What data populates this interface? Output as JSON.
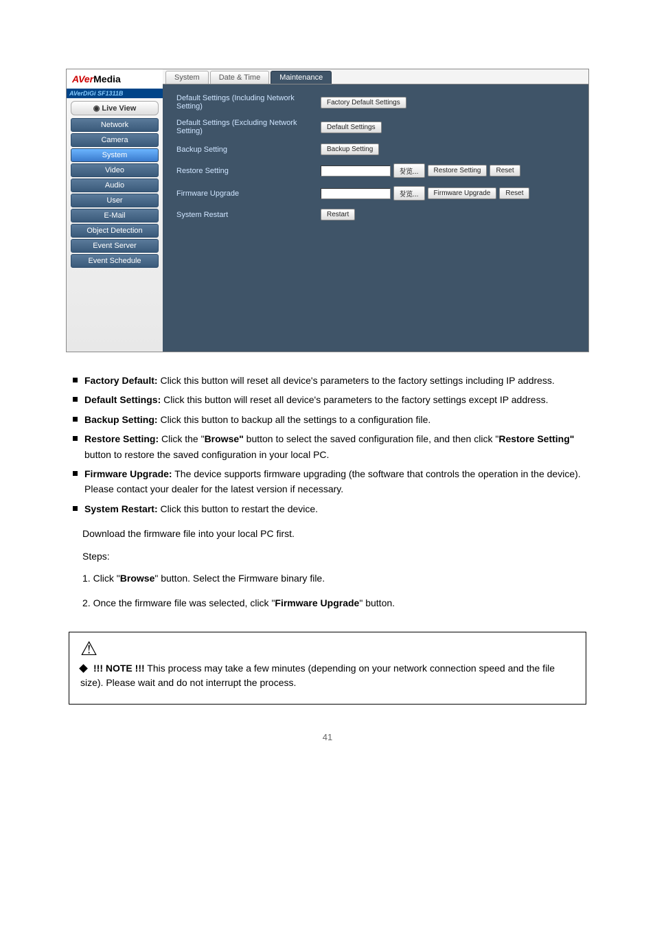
{
  "screenshot": {
    "sidebar": {
      "logo_part1": "AVer",
      "logo_part2": "Media",
      "sublogo": "AVerDiGi SF1311B",
      "live_view": "◉ Live View",
      "items": [
        "Network",
        "Camera",
        "System",
        "Video",
        "Audio",
        "User",
        "E-Mail",
        "Object Detection",
        "Event Server",
        "Event Schedule"
      ],
      "active_index": 2
    },
    "tabs": [
      "System",
      "Date & Time",
      "Maintenance"
    ],
    "active_tab": 2,
    "rows": {
      "r1_label": "Default Settings (Including Network Setting)",
      "r1_btn": "Factory Default Settings",
      "r2_label": "Default Settings (Excluding Network Setting)",
      "r2_btn": "Default Settings",
      "r3_label": "Backup Setting",
      "r3_btn": "Backup Setting",
      "r4_label": "Restore Setting",
      "r4_browse": "찾览...",
      "r4_btn1": "Restore Setting",
      "r4_btn2": "Reset",
      "r5_label": "Firmware Upgrade",
      "r5_browse": "찾览...",
      "r5_btn1": "Firmware Upgrade",
      "r5_btn2": "Reset",
      "r6_label": "System Restart",
      "r6_btn": "Restart"
    }
  },
  "bullets": {
    "b1a": "Factory Default:",
    "b1b": " Click this butt",
    "b1c": "on will reset all device's parameters to the factory settings ",
    "b1d": "including IP address.",
    "b2a": "Default Settings:",
    "b2b": " Click this button will reset all device's parameters to the factory settings except IP address.",
    "b3a": "Backup Setting:",
    "b3b": " Click this button to backup all the settings to a configuration file.",
    "b4a": "Restore Setting:",
    "b4b": " ",
    "b4c": "Click the \"",
    "b4d": "Browse\"",
    "b4e": " button to select the saved configuration file, and then click ",
    "b4f": "\"",
    "b4g": "Restore Setting\"",
    "b4h": " button to restore the saved configuration in your local PC.",
    "b5a": "Firmware Upgrade:",
    "b5b": " The device supports firmware upgrading (the software that controls the operation in the device). Please contact your dealer for the latest version if necessary.",
    "b6a": "System Restart:",
    "b6b": " Click this button to restart the device."
  },
  "download": "Download the firmware file into your local PC first.",
  "steps_intro": "Steps:",
  "step1_num": "1.",
  "step1a": "Click \"",
  "step1b": "Browse",
  "step1c": "\" button. Select the Firmware binary file.",
  "step2_num": "2.",
  "step2a": "Once the firmware file was selected, click \"",
  "step2b": "Firmware Upgrade",
  "step2c": "\" button.",
  "note_label": "!!! NOTE !!!",
  "note_text": "This process may take a few minutes (depending on your network connection speed and the file size). Please wait and do not interrupt the process.",
  "page": "41"
}
